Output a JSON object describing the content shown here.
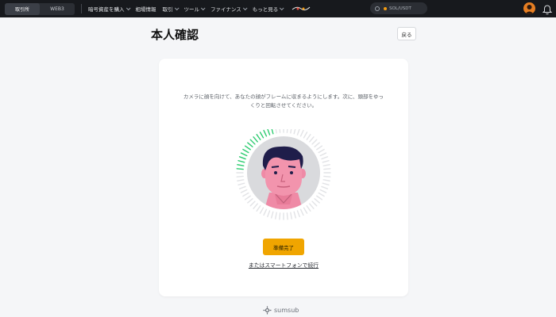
{
  "nav": {
    "segments": [
      "取引所",
      "WEB3"
    ],
    "items": [
      "暗号資産を購入",
      "相場情報",
      "取引",
      "ツール",
      "ファイナンス",
      "もっと見る"
    ],
    "search": {
      "text": "SOL/USDT"
    }
  },
  "page": {
    "title": "本人確認",
    "back_label": "戻る"
  },
  "card": {
    "instruction": "カメラに顔を向けて、あなたの顔がフレームに収まるようにします。次に、頭部をゆっくりと回転させてください。",
    "ready_label": "準備完了",
    "phone_link": "またはスマートフォンで続行"
  },
  "footer": {
    "brand": "sumsub"
  },
  "colors": {
    "nav_bg": "#17191d",
    "accent": "#f0a500",
    "progress": "#2ecc71",
    "page_bg": "#f5f6f8"
  }
}
